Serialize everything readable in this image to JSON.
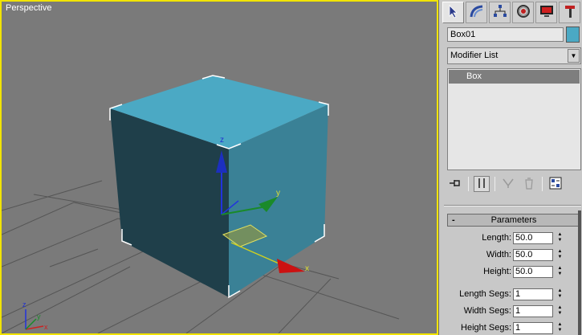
{
  "viewport": {
    "label": "Perspective",
    "axes": {
      "x": "x",
      "y": "y",
      "z": "z"
    },
    "mini_axes": {
      "x": "x",
      "y": "y",
      "z": "z"
    }
  },
  "colors": {
    "viewport_bg": "#7a7a7a",
    "active_border": "#f2e400",
    "box_top": "#4ba9c4",
    "box_left": "#1f3f4a",
    "box_right": "#3a8196",
    "object_color": "#4ba9c4"
  },
  "panel": {
    "tabs": [
      {
        "name": "create-tab",
        "icon": "cursor-icon",
        "active": true
      },
      {
        "name": "modify-tab",
        "icon": "modify-arc-icon",
        "active": false
      },
      {
        "name": "hierarchy-tab",
        "icon": "hierarchy-icon",
        "active": false
      },
      {
        "name": "motion-tab",
        "icon": "motion-wheel-icon",
        "active": false
      },
      {
        "name": "display-tab",
        "icon": "display-monitor-icon",
        "active": false
      },
      {
        "name": "utilities-tab",
        "icon": "hammer-icon",
        "active": false
      }
    ],
    "object_name": "Box01",
    "modifier_list": "Modifier List",
    "stack_items": [
      "Box"
    ],
    "parameters": {
      "title": "Parameters",
      "collapse": "-",
      "fields": [
        {
          "label": "Length:",
          "value": "50.0"
        },
        {
          "label": "Width:",
          "value": "50.0"
        },
        {
          "label": "Height:",
          "value": "50.0"
        },
        {
          "label": "Length Segs:",
          "value": "1"
        },
        {
          "label": "Width Segs:",
          "value": "1"
        },
        {
          "label": "Height Segs:",
          "value": "1"
        }
      ]
    }
  }
}
